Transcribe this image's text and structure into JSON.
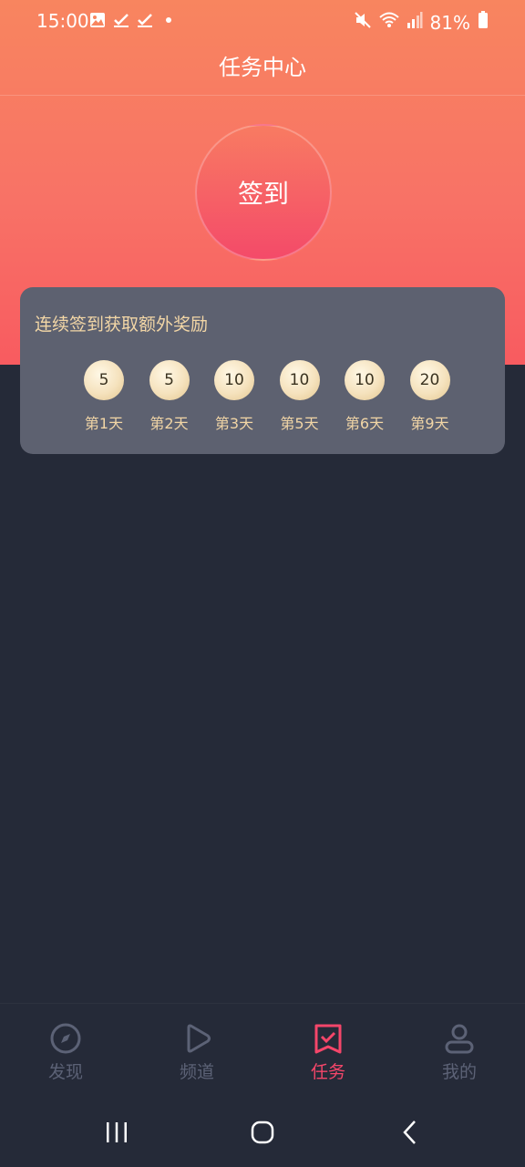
{
  "status_bar": {
    "time": "15:00",
    "battery": "81%",
    "left_icons": [
      "image-icon",
      "check-icon",
      "check-icon",
      "dot-icon"
    ],
    "right_icons": [
      "mute-icon",
      "wifi-icon",
      "signal-icon",
      "battery-icon"
    ]
  },
  "header": {
    "title": "任务中心"
  },
  "checkin_button": {
    "label": "签到"
  },
  "streak_card": {
    "heading": "连续签到获取额外奖励",
    "rewards": [
      {
        "points": "5",
        "day": "第1天"
      },
      {
        "points": "5",
        "day": "第2天"
      },
      {
        "points": "10",
        "day": "第3天"
      },
      {
        "points": "10",
        "day": "第5天"
      },
      {
        "points": "10",
        "day": "第6天"
      },
      {
        "points": "20",
        "day": "第9天"
      }
    ]
  },
  "tab_bar": {
    "tabs": [
      {
        "label": "发现",
        "icon": "compass-icon",
        "active": false
      },
      {
        "label": "频道",
        "icon": "play-icon",
        "active": false
      },
      {
        "label": "任务",
        "icon": "task-check-icon",
        "active": true
      },
      {
        "label": "我的",
        "icon": "user-icon",
        "active": false
      }
    ],
    "active_color": "#f5466a",
    "inactive_color": "#5c6276"
  },
  "system_nav": {
    "icons": [
      "recent-apps-icon",
      "home-icon",
      "back-icon"
    ]
  },
  "colors": {
    "background": "#252a38",
    "hero_top": "#f8855f",
    "hero_bottom": "#f85b60",
    "card": "#5d6170",
    "gold_text": "#f2d6a6"
  }
}
